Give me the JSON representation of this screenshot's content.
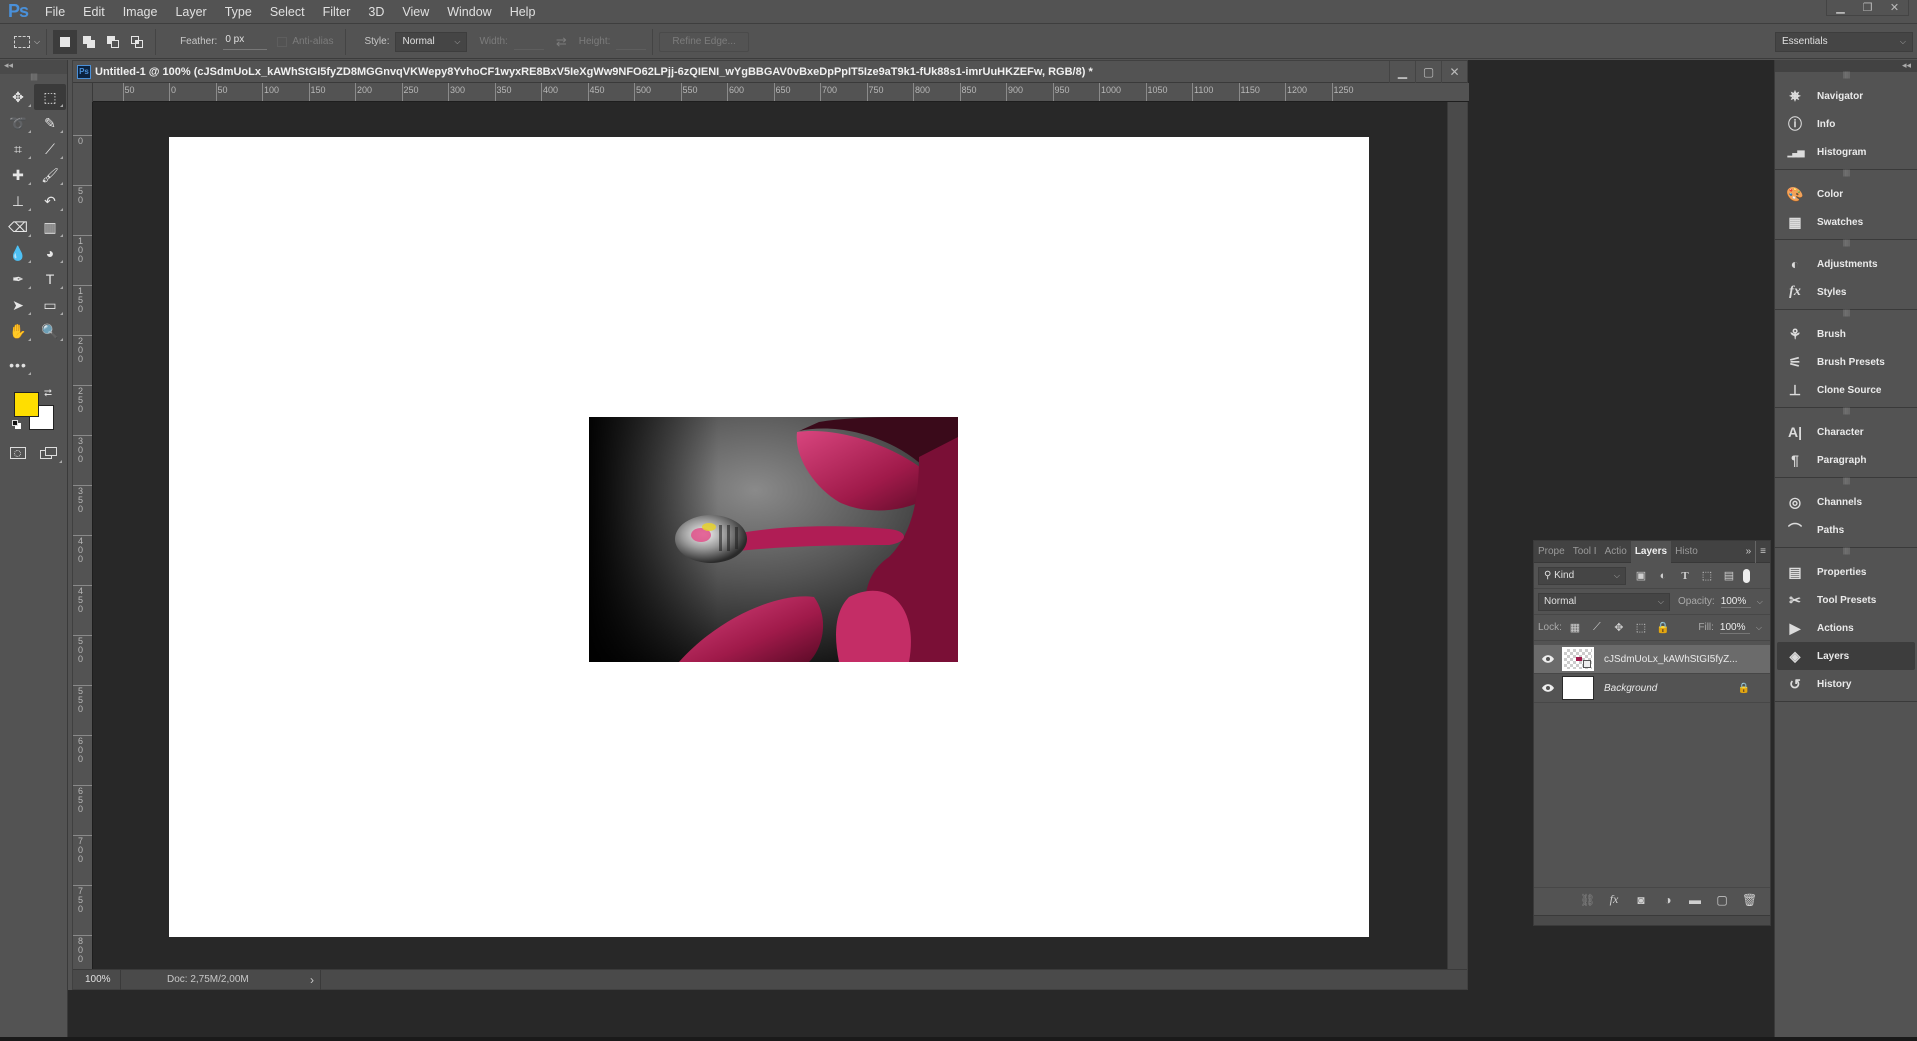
{
  "app": {
    "logo": "Ps",
    "menu": [
      "File",
      "Edit",
      "Image",
      "Layer",
      "Type",
      "Select",
      "Filter",
      "3D",
      "View",
      "Window",
      "Help"
    ],
    "window_controls": [
      "minimize-icon",
      "restore-icon",
      "close-icon"
    ]
  },
  "options_bar": {
    "tool_icon": "rectangular-marquee-icon",
    "selection_modes": [
      "new-selection",
      "add-to-selection",
      "subtract-from-selection",
      "intersect-selection"
    ],
    "feather_label": "Feather:",
    "feather_value": "0 px",
    "antialias_label": "Anti-alias",
    "style_label": "Style:",
    "style_value": "Normal",
    "width_label": "Width:",
    "height_label": "Height:",
    "refine_edge_label": "Refine Edge...",
    "workspace_value": "Essentials"
  },
  "tools": [
    {
      "name": "move-tool",
      "glyph": "✥"
    },
    {
      "name": "rectangular-marquee-tool",
      "glyph": "⬚",
      "active": true
    },
    {
      "name": "lasso-tool",
      "glyph": "➰"
    },
    {
      "name": "quick-selection-tool",
      "glyph": "✎"
    },
    {
      "name": "crop-tool",
      "glyph": "⌗"
    },
    {
      "name": "eyedropper-tool",
      "glyph": "⟋"
    },
    {
      "name": "healing-brush-tool",
      "glyph": "✚"
    },
    {
      "name": "brush-tool",
      "glyph": "🖌"
    },
    {
      "name": "clone-stamp-tool",
      "glyph": "⊥"
    },
    {
      "name": "history-brush-tool",
      "glyph": "↶"
    },
    {
      "name": "eraser-tool",
      "glyph": "⌫"
    },
    {
      "name": "gradient-tool",
      "glyph": "▥"
    },
    {
      "name": "blur-tool",
      "glyph": "💧"
    },
    {
      "name": "dodge-tool",
      "glyph": "◕"
    },
    {
      "name": "pen-tool",
      "glyph": "✒"
    },
    {
      "name": "type-tool",
      "glyph": "T"
    },
    {
      "name": "path-selection-tool",
      "glyph": "➤"
    },
    {
      "name": "rectangle-tool",
      "glyph": "▭"
    },
    {
      "name": "hand-tool",
      "glyph": "✋"
    },
    {
      "name": "zoom-tool",
      "glyph": "🔍"
    }
  ],
  "colors": {
    "foreground": "#ffde00",
    "background": "#ffffff",
    "ps_blue": "#4a90d9"
  },
  "document": {
    "title": "Untitled-1 @ 100% (cJSdmUoLx_kAWhStGI5fyZD8MGGnvqVKWepy8YvhoCF1wyxRE8BxV5IeXgWw9NFO62LPjj-6zQIENI_wYgBBGAV0vBxeDpPpIT5Ize9aT9k1-fUk88s1-imrUuHKZEFw, RGB/8) *",
    "hruler_labels": [
      "50",
      "0",
      "50",
      "100",
      "150",
      "200",
      "250",
      "300",
      "350",
      "400",
      "450",
      "500",
      "550",
      "600",
      "650",
      "700",
      "750",
      "800",
      "850",
      "900",
      "950",
      "1000",
      "1050",
      "1100",
      "1150",
      "1200",
      "1250"
    ],
    "vruler_labels": [
      "0",
      "50",
      "100",
      "150",
      "200",
      "250",
      "300",
      "350",
      "400",
      "450",
      "500",
      "550",
      "600",
      "650",
      "700",
      "750",
      "800"
    ],
    "zoom": "100%",
    "doc_size": "Doc: 2,75M/2,00M"
  },
  "layers_panel": {
    "tabs": [
      "Prope",
      "Tool I",
      "Actio",
      "Layers",
      "Histo"
    ],
    "active_tab": "Layers",
    "filter_label": "Kind",
    "blend_mode": "Normal",
    "opacity_label": "Opacity:",
    "opacity_value": "100%",
    "lock_label": "Lock:",
    "fill_label": "Fill:",
    "fill_value": "100%",
    "layers": [
      {
        "name": "cJSdmUoLx_kAWhStGI5fyZ...",
        "visible": true,
        "selected": true,
        "smart_object": true
      },
      {
        "name": "Background",
        "visible": true,
        "selected": false,
        "locked": true
      }
    ],
    "footer_icons": [
      "link-layers-icon",
      "fx-icon",
      "add-mask-icon",
      "adjustment-layer-icon",
      "group-folder-icon",
      "new-layer-icon",
      "delete-icon"
    ]
  },
  "dock": {
    "groups": [
      [
        {
          "label": "Navigator",
          "icon": "navigator-icon"
        },
        {
          "label": "Info",
          "icon": "info-icon"
        },
        {
          "label": "Histogram",
          "icon": "histogram-icon"
        }
      ],
      [
        {
          "label": "Color",
          "icon": "color-palette-icon"
        },
        {
          "label": "Swatches",
          "icon": "swatches-icon"
        }
      ],
      [
        {
          "label": "Adjustments",
          "icon": "adjustments-icon"
        },
        {
          "label": "Styles",
          "icon": "styles-icon"
        }
      ],
      [
        {
          "label": "Brush",
          "icon": "brush-icon"
        },
        {
          "label": "Brush Presets",
          "icon": "brush-presets-icon"
        },
        {
          "label": "Clone Source",
          "icon": "clone-source-icon"
        }
      ],
      [
        {
          "label": "Character",
          "icon": "character-icon"
        },
        {
          "label": "Paragraph",
          "icon": "paragraph-icon"
        }
      ],
      [
        {
          "label": "Channels",
          "icon": "channels-icon"
        },
        {
          "label": "Paths",
          "icon": "paths-icon"
        }
      ],
      [
        {
          "label": "Properties",
          "icon": "properties-icon"
        },
        {
          "label": "Tool Presets",
          "icon": "tool-presets-icon"
        },
        {
          "label": "Actions",
          "icon": "actions-icon"
        },
        {
          "label": "Layers",
          "icon": "layers-icon",
          "active": true
        },
        {
          "label": "History",
          "icon": "history-icon"
        }
      ]
    ]
  }
}
